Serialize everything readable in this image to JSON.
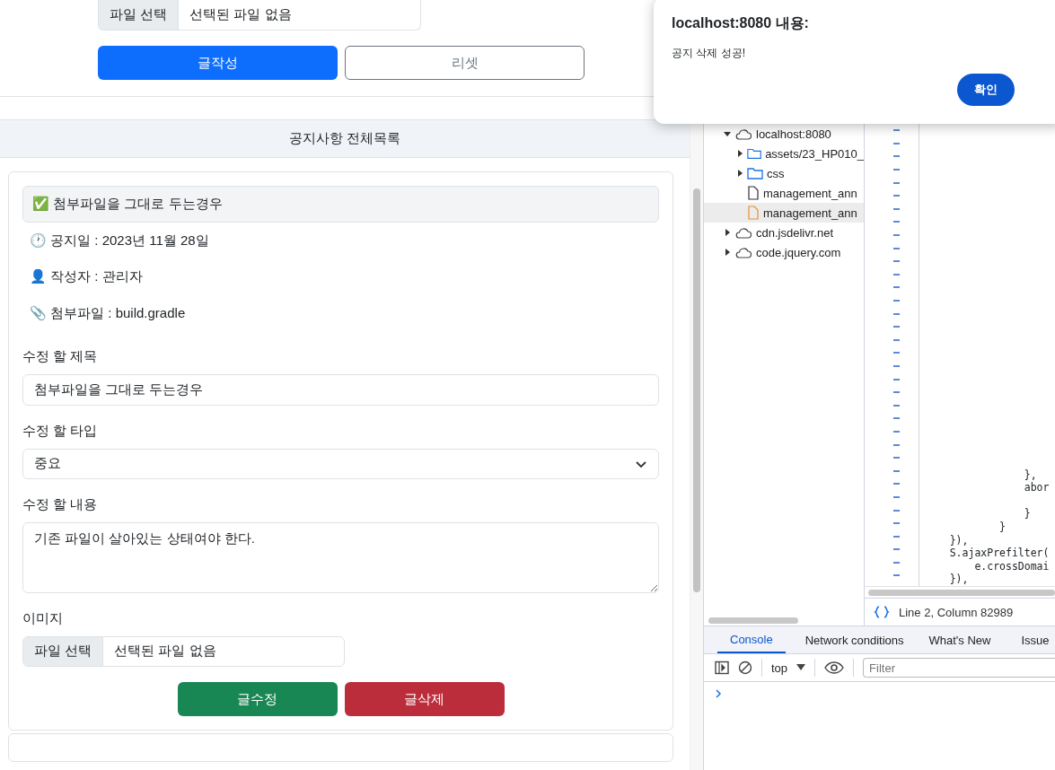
{
  "top_form": {
    "file_button": "파일 선택",
    "file_status": "선택된 파일 없음",
    "buttons": [
      {
        "label": "글작성",
        "kind": "primary"
      },
      {
        "label": "리셋",
        "kind": "outline"
      }
    ]
  },
  "list_header": "공지사항 전체목록",
  "notice": {
    "title": "✅ 첨부파일을 그대로 두는경우",
    "info": [
      "🕐 공지일 : 2023년 11월 28일",
      "👤 작성자 : 관리자",
      "📎 첨부파일 : build.gradle"
    ],
    "title_label": "수정 할 제목",
    "title_value": "첨부파일을 그대로 두는경우",
    "type_label": "수정 할 타입",
    "type_value": "중요",
    "content_label": "수정 할 내용",
    "content_value": "기존 파일이 살아있는 상태여야 한다.",
    "image_label": "이미지",
    "file_button": "파일 선택",
    "file_status": "선택된 파일 없음",
    "buttons": [
      {
        "label": "글수정",
        "kind": "success"
      },
      {
        "label": "글삭제",
        "kind": "danger"
      }
    ]
  },
  "dialog": {
    "title": "localhost:8080 내용:",
    "message": "공지 삭제 성공!",
    "button": "확인"
  },
  "file_tree": [
    {
      "label": "localhost:8080",
      "kind": "cloud",
      "expanded": true,
      "selected": false,
      "children": [
        {
          "label": "assets/23_HP010_",
          "kind": "folder",
          "expanded": false,
          "selected": false
        },
        {
          "label": "css",
          "kind": "folder",
          "expanded": false,
          "selected": false
        },
        {
          "label": "management_ann",
          "kind": "file",
          "selected": false
        },
        {
          "label": "management_ann",
          "kind": "script",
          "selected": true
        }
      ]
    },
    {
      "label": "cdn.jsdelivr.net",
      "kind": "cloud",
      "expanded": false,
      "selected": false
    },
    {
      "label": "code.jquery.com",
      "kind": "cloud",
      "expanded": false,
      "selected": false
    }
  ],
  "code_blocks": [
    [
      "                },",
      "                abor"
    ],
    [
      "                }",
      "            }",
      "    }),",
      "    S.ajaxPrefilter(",
      "        e.crossDomai",
      "    }),"
    ]
  ],
  "status": "Line 2, Column 82989",
  "drawer_tabs": [
    {
      "label": "Console",
      "selected": true
    },
    {
      "label": "Network conditions",
      "selected": false
    },
    {
      "label": "What's New",
      "selected": false
    },
    {
      "label": "Issue",
      "selected": false
    }
  ],
  "console_context": "top",
  "filter": {
    "placeholder": "Filter"
  }
}
